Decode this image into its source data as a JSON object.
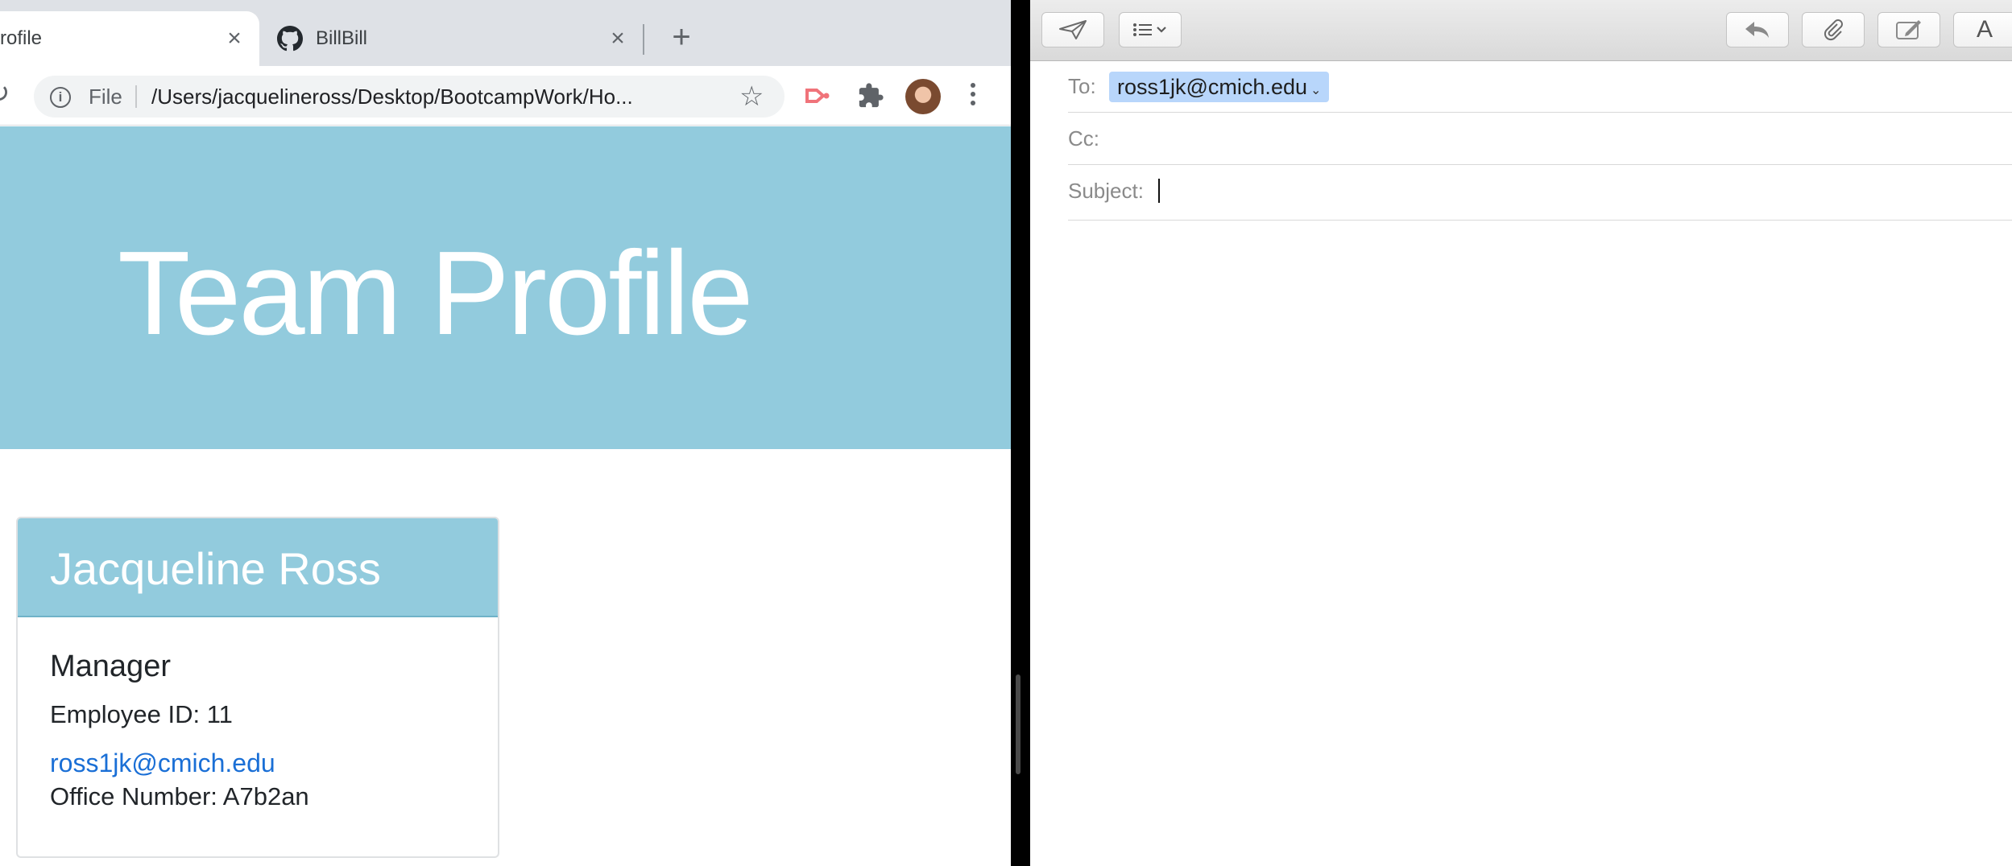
{
  "browser": {
    "tabs": [
      {
        "title": "rofile",
        "active": true
      },
      {
        "title": "BillBill",
        "active": false
      }
    ],
    "address": {
      "scheme_label": "File",
      "url": "/Users/jacquelineross/Desktop/BootcampWork/Ho..."
    },
    "icons": {
      "tab_close": "close-icon",
      "new_tab": "plus-icon",
      "favicon": "github-icon",
      "info": "info-icon",
      "star": "star-icon",
      "extension": "extension-icon",
      "puzzle": "puzzle-icon",
      "menu": "kebab-menu-icon"
    },
    "colors": {
      "tabstrip": "#dee1e6",
      "omnibox": "#f1f3f4"
    }
  },
  "page": {
    "title": "Team Profile",
    "card": {
      "name": "Jacqueline Ross",
      "role": "Manager",
      "employee_id": "Employee ID: 11",
      "email": "ross1jk@cmich.edu",
      "office": "Office Number: A7b2an"
    },
    "colors": {
      "accent": "#92cbdd",
      "link": "#1a6fd6"
    }
  },
  "mail": {
    "to_label": "To:",
    "to_recipient": "ross1jk@cmich.edu",
    "cc_label": "Cc:",
    "subject_label": "Subject:",
    "subject_value": "",
    "toolbar_icons": [
      "send-icon",
      "list-format-icon",
      "reply-icon",
      "attachment-icon",
      "markup-icon",
      "font-icon"
    ],
    "font_button_label": "A"
  }
}
